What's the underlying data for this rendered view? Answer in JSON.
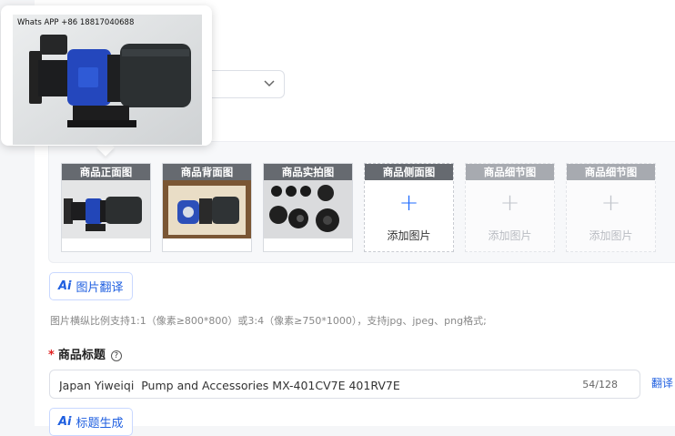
{
  "popover": {
    "watermark": "Whats APP +86 18817040688"
  },
  "images": {
    "slots": [
      {
        "label": "商品正面图",
        "state": "filled"
      },
      {
        "label": "商品背面图",
        "state": "filled"
      },
      {
        "label": "商品实拍图",
        "state": "filled"
      },
      {
        "label": "商品侧面图",
        "state": "empty",
        "add_text": "添加图片"
      },
      {
        "label": "商品细节图",
        "state": "disabled",
        "add_text": "添加图片"
      },
      {
        "label": "商品细节图",
        "state": "disabled",
        "add_text": "添加图片"
      }
    ],
    "ai_translate_label": "图片翻译",
    "hint": "图片横纵比例支持1:1（像素≥800*800）或3:4（像素≥750*1000），支持jpg、jpeg、png格式;"
  },
  "title_field": {
    "required_mark": "*",
    "label": "商品标题",
    "value": "Japan Yiweiqi  Pump and Accessories MX-401CV7E 401RV7E",
    "counter": "54/128",
    "translate_link": "翻译",
    "ai_generate_label": "标题生成"
  },
  "icons": {
    "ai_mark": "Ai",
    "plus": "+",
    "help": "?"
  },
  "colors": {
    "accent": "#1f5fe0",
    "required": "#e02020",
    "slot_header": "#666a70"
  }
}
